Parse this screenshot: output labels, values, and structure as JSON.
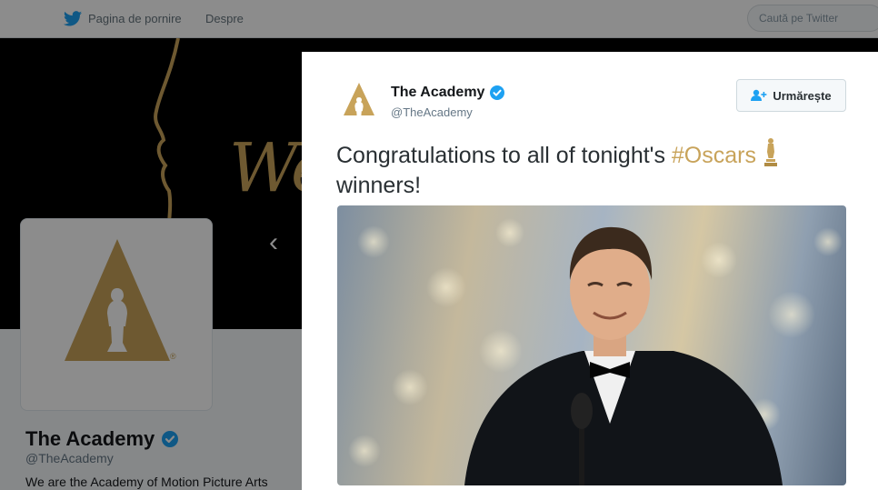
{
  "nav": {
    "home_label": "Pagina de pornire",
    "about_label": "Despre",
    "search_placeholder": "Caută pe Twitter"
  },
  "profile": {
    "name": "The Academy",
    "handle": "@TheAcademy",
    "bio": "We are the Academy of Motion Picture Arts",
    "banner_text": "We"
  },
  "tweet": {
    "author_name": "The Academy",
    "author_handle": "@TheAcademy",
    "follow_label": "Urmărește",
    "text_prefix": "Congratulations to all of tonight's ",
    "hashtag": "#Oscars",
    "text_suffix": "winners!",
    "media_alt": "Leonardo DiCaprio smiling on stage"
  },
  "colors": {
    "twitter_blue": "#1da1f2",
    "oscar_gold": "#c8a35a",
    "verified": "#1da1f2",
    "text_dark": "#14171a",
    "text_muted": "#657786"
  },
  "icons": {
    "home": "twitter-bird-icon",
    "carousel_prev": "chevron-left-icon",
    "verified": "verified-badge-icon",
    "follow": "add-user-icon",
    "oscar": "oscar-statuette-icon"
  }
}
